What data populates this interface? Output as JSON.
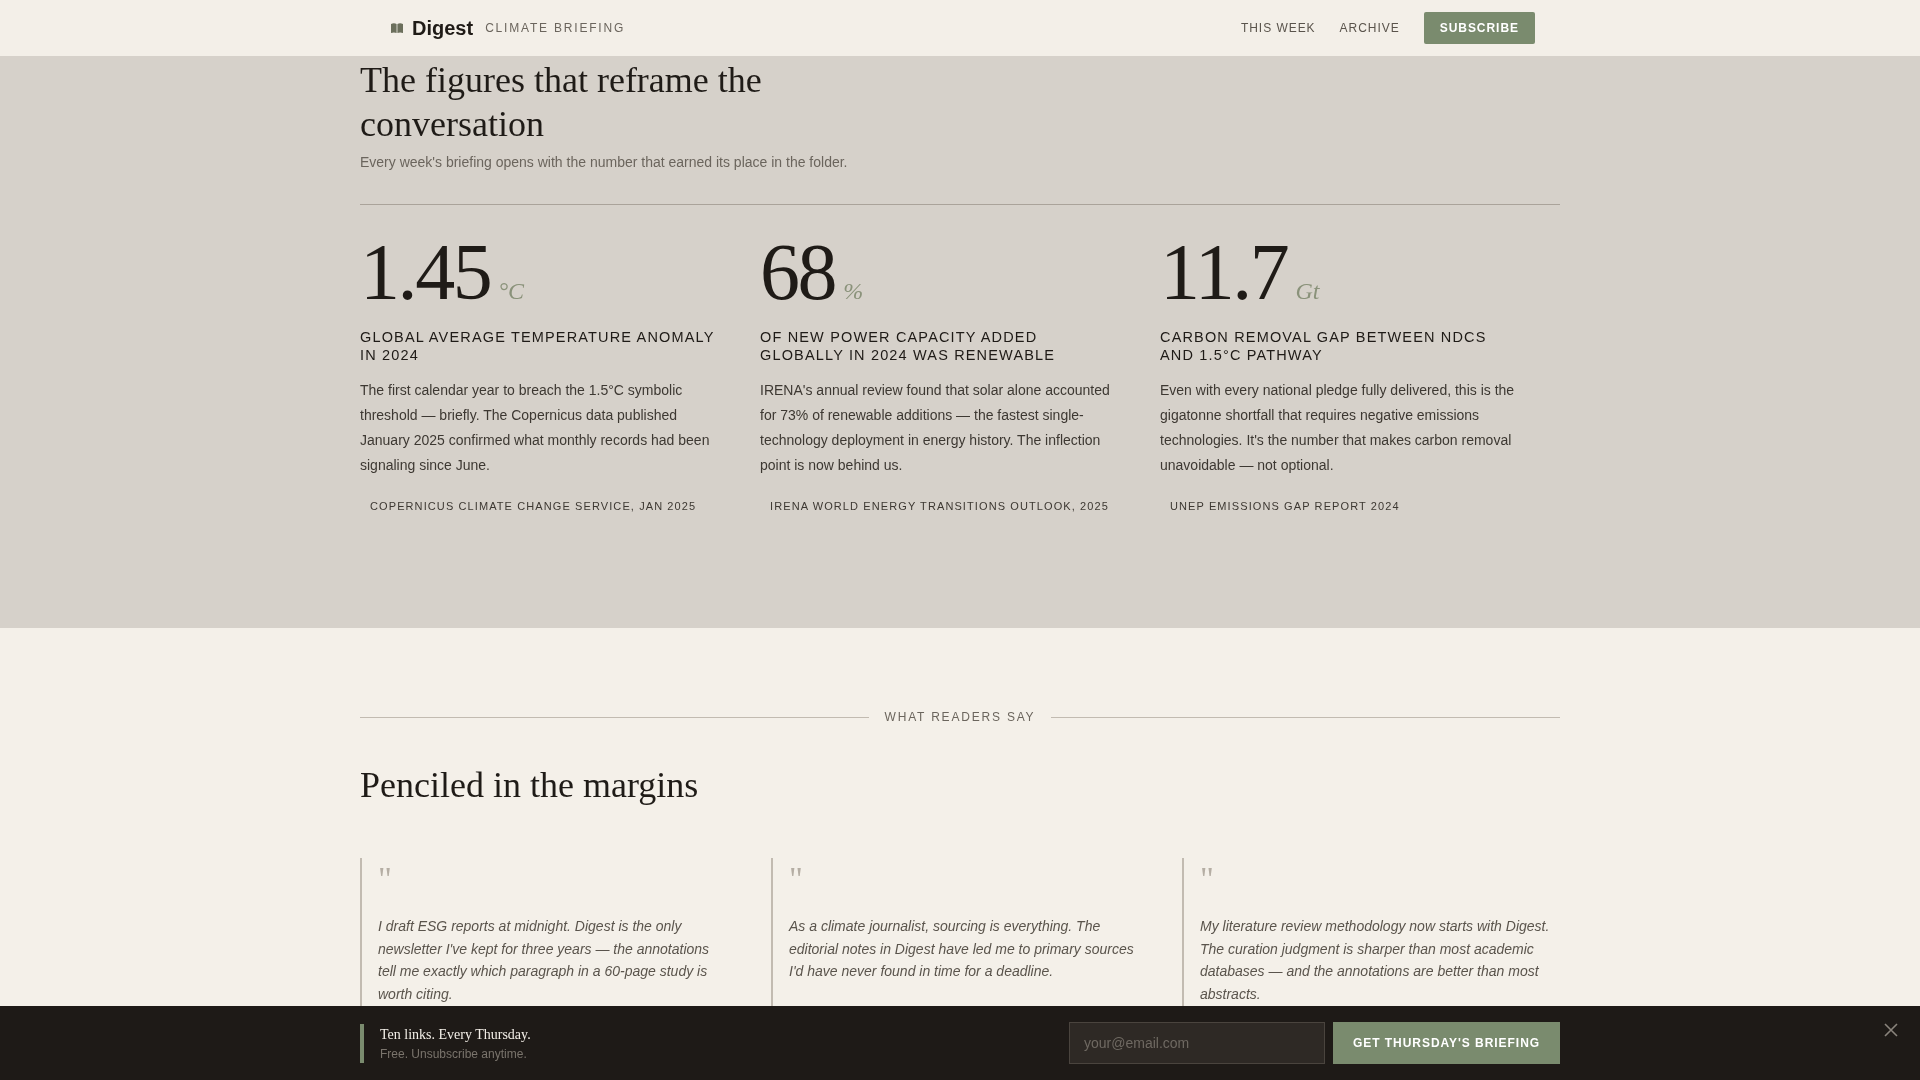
{
  "header": {
    "logo": "Digest",
    "tagline": "CLIMATE BRIEFING",
    "nav": [
      {
        "label": "THIS WEEK"
      },
      {
        "label": "ARCHIVE"
      }
    ],
    "cta": "SUBSCRIBE"
  },
  "figures": {
    "title": "The figures that reframe the conversation",
    "subtitle": "Every week's briefing opens with the number that earned its place in the folder.",
    "stats": [
      {
        "value": "1.45",
        "unit": "°C",
        "label": "GLOBAL AVERAGE TEMPERATURE ANOMALY IN 2024",
        "body": "The first calendar year to breach the 1.5°C symbolic threshold — briefly. The Copernicus data published January 2025 confirmed what monthly records had been signaling since June.",
        "source": "COPERNICUS CLIMATE CHANGE SERVICE, JAN 2025"
      },
      {
        "value": "68",
        "unit": "%",
        "label": "OF NEW POWER CAPACITY ADDED GLOBALLY IN 2024 WAS RENEWABLE",
        "body": "IRENA's annual review found that solar alone accounted for 73% of renewable additions — the fastest single-technology deployment in energy history. The inflection point is now behind us.",
        "source": "IRENA WORLD ENERGY TRANSITIONS OUTLOOK, 2025"
      },
      {
        "value": "11.7",
        "unit": "Gt",
        "label": "CARBON REMOVAL GAP BETWEEN NDCS AND 1.5°C PATHWAY",
        "body": "Even with every national pledge fully delivered, this is the gigatonne shortfall that requires negative emissions technologies. It's the number that makes carbon removal unavoidable — not optional.",
        "source": "UNEP EMISSIONS GAP REPORT 2024"
      }
    ]
  },
  "testimonials": {
    "eyebrow": "WHAT READERS SAY",
    "title": "Penciled in the margins",
    "quotes": [
      {
        "mark": "\"",
        "text": "I draft ESG reports at midnight. Digest is the only newsletter I've kept for three years — the annotations tell me exactly which paragraph in a 60-page study is worth citing."
      },
      {
        "mark": "\"",
        "text": "As a climate journalist, sourcing is everything. The editorial notes in Digest have led me to primary sources I'd have never found in time for a deadline."
      },
      {
        "mark": "\"",
        "text": "My literature review methodology now starts with Digest. The curation judgment is sharper than most academic databases — and the annotations are better than most abstracts."
      }
    ]
  },
  "signup_bar": {
    "headline": "Ten links. Every Thursday.",
    "note": "Free. Unsubscribe anytime.",
    "placeholder": "your@email.com",
    "button": "GET THURSDAY'S BRIEFING"
  }
}
